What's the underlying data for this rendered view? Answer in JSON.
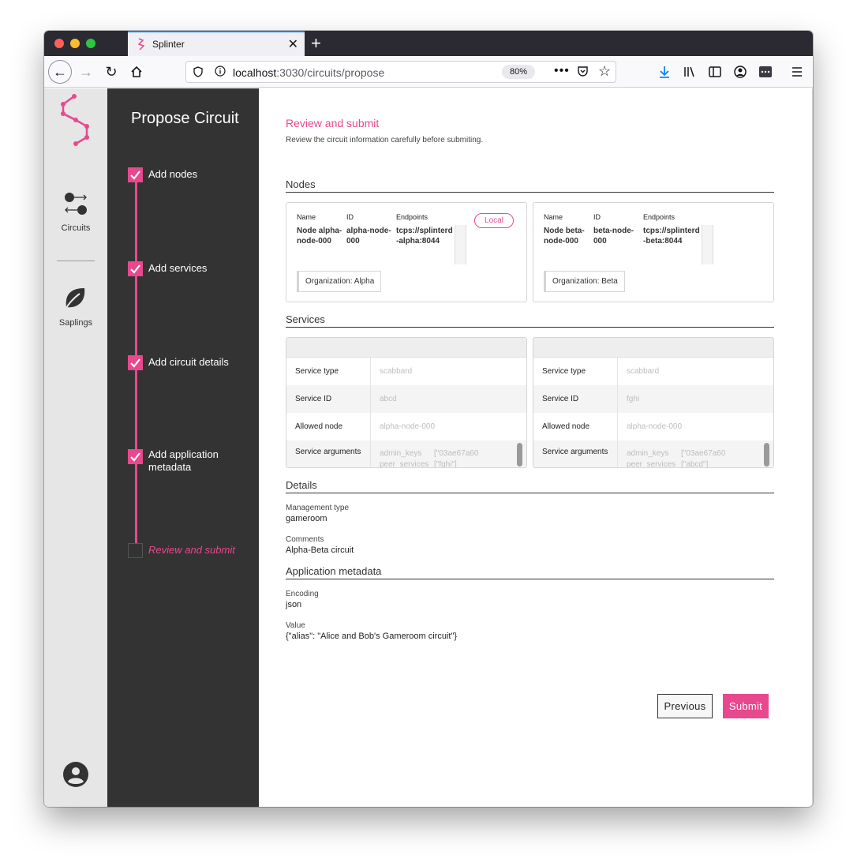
{
  "browser": {
    "tab_title": "Splinter",
    "url_host": "localhost",
    "url_path": ":3030/circuits/propose",
    "zoom": "80%"
  },
  "rail": {
    "items": [
      {
        "label": "Circuits",
        "icon": "circuits-icon"
      },
      {
        "label": "Saplings",
        "icon": "leaf-icon"
      }
    ]
  },
  "stepper": {
    "title": "Propose Circuit",
    "steps": [
      {
        "label": "Add nodes",
        "done": true
      },
      {
        "label": "Add services",
        "done": true
      },
      {
        "label": "Add circuit details",
        "done": true
      },
      {
        "label": "Add application metadata",
        "done": true
      },
      {
        "label": "Review and submit",
        "done": false
      }
    ]
  },
  "main": {
    "title": "Review and submit",
    "subtitle": "Review the circuit information carefully before submiting.",
    "nodes_heading": "Nodes",
    "node_cols": {
      "name": "Name",
      "id": "ID",
      "endpoints": "Endpoints"
    },
    "nodes": [
      {
        "name": "Node alpha-node-000",
        "id": "alpha-node-000",
        "endpoint": "tcps://splinterd-alpha:8044",
        "org": "Organization: Alpha",
        "badge": "Local"
      },
      {
        "name": "Node beta-node-000",
        "id": "beta-node-000",
        "endpoint": "tcps://splinterd-beta:8044",
        "org": "Organization: Beta"
      }
    ],
    "services_heading": "Services",
    "service_keys": {
      "type": "Service type",
      "id": "Service ID",
      "allowed": "Allowed node",
      "args": "Service arguments"
    },
    "services": [
      {
        "type": "scabbard",
        "id": "abcd",
        "allowed": "alpha-node-000",
        "arg_keys": "admin_keys\npeer_services",
        "arg_vals": "[\"03ae67a60\n[\"fghi\"]"
      },
      {
        "type": "scabbard",
        "id": "fghi",
        "allowed": "alpha-node-000",
        "arg_keys": "admin_keys\npeer_services",
        "arg_vals": "[\"03ae67a60\n[\"abcd\"]"
      }
    ],
    "details_heading": "Details",
    "management_label": "Management type",
    "management_value": "gameroom",
    "comments_label": "Comments",
    "comments_value": "Alpha-Beta circuit",
    "appmeta_heading": "Application metadata",
    "encoding_label": "Encoding",
    "encoding_value": "json",
    "value_label": "Value",
    "value_value": "{\"alias\": \"Alice and Bob's Gameroom circuit\"}",
    "previous_label": "Previous",
    "submit_label": "Submit"
  }
}
